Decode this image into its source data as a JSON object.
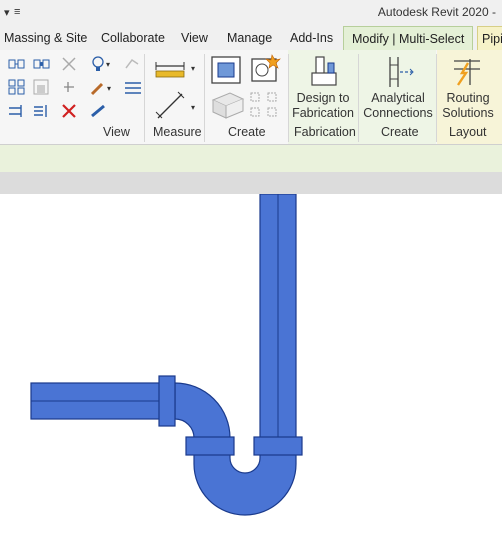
{
  "window": {
    "title": "Autodesk Revit 2020 -"
  },
  "tabs": [
    {
      "label": "Massing & Site"
    },
    {
      "label": "Collaborate"
    },
    {
      "label": "View"
    },
    {
      "label": "Manage"
    },
    {
      "label": "Add-Ins"
    },
    {
      "label": "Modify | Multi-Select"
    },
    {
      "label": "Pipi"
    }
  ],
  "ribbon": {
    "panels": {
      "view": "View",
      "measure": "Measure",
      "create": "Create",
      "fabrication": "Fabrication",
      "create2": "Create",
      "layout": "Layout"
    },
    "buttons": {
      "design_fabrication_l1": "Design to",
      "design_fabrication_l2": "Fabrication",
      "analytical_l1": "Analytical",
      "analytical_l2": "Connections",
      "routing_l1": "Routing",
      "routing_l2": "Solutions"
    }
  },
  "colors": {
    "pipe_fill": "#4a74d4",
    "pipe_stroke": "#1a3a8c",
    "context_tab": "#e4f0d6",
    "options_bar": "#eaf2dc"
  }
}
